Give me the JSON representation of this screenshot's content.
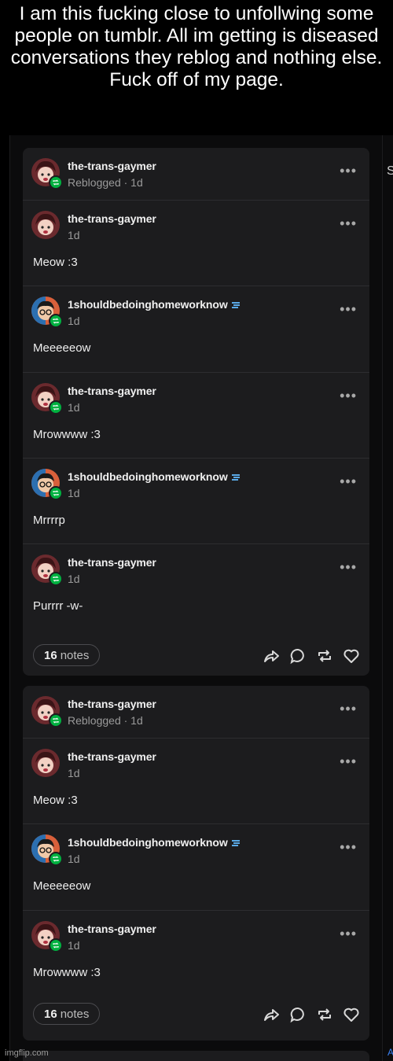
{
  "caption": "I am this fucking close to unfollwing some people on tumblr. All im getting is diseased conversations they reblog and nothing else. Fuck off of my page.",
  "side": {
    "s_letter": "S",
    "a_letter": "A"
  },
  "watermark": "imgflip.com",
  "colors": {
    "reblog_badge": "#00b140",
    "card_bg": "#1c1c1e",
    "verified_badge": "#5aa9e6"
  },
  "posts": [
    {
      "reblogger": {
        "name": "the-trans-gaymer",
        "meta": "Reblogged · 1d",
        "avatar_icon": "anime-avatar-icon"
      },
      "entries": [
        {
          "name": "the-trans-gaymer",
          "time": "1d",
          "text": "Meow :3",
          "verified": false
        },
        {
          "name": "1shouldbedoinghomeworknow",
          "time": "1d",
          "text": "Meeeeeow",
          "verified": true
        },
        {
          "name": "the-trans-gaymer",
          "time": "1d",
          "text": "Mrowwww :3",
          "verified": false
        },
        {
          "name": "1shouldbedoinghomeworknow",
          "time": "1d",
          "text": "Mrrrrp",
          "verified": true
        },
        {
          "name": "the-trans-gaymer",
          "time": "1d",
          "text": "Purrrr -w-",
          "verified": false
        }
      ],
      "notes_count": "16",
      "notes_label": "notes"
    },
    {
      "reblogger": {
        "name": "the-trans-gaymer",
        "meta": "Reblogged · 1d",
        "avatar_icon": "anime-avatar-icon"
      },
      "entries": [
        {
          "name": "the-trans-gaymer",
          "time": "1d",
          "text": "Meow :3",
          "verified": false
        },
        {
          "name": "1shouldbedoinghomeworknow",
          "time": "1d",
          "text": "Meeeeeow",
          "verified": true
        },
        {
          "name": "the-trans-gaymer",
          "time": "1d",
          "text": "Mrowwww :3",
          "verified": false
        }
      ],
      "notes_count": "16",
      "notes_label": "notes"
    }
  ]
}
